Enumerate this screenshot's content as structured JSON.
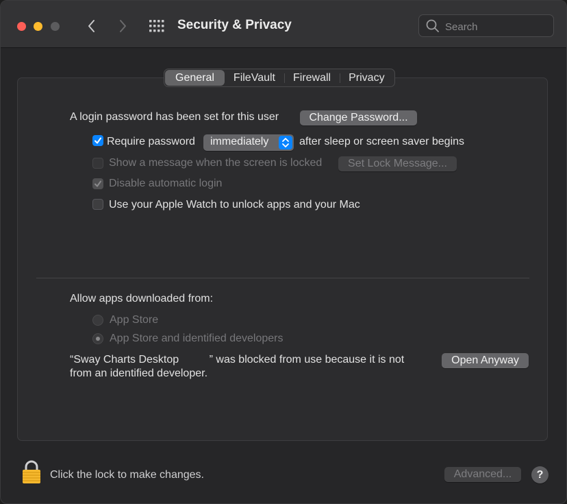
{
  "window": {
    "title": "Security & Privacy",
    "search_placeholder": "Search"
  },
  "tabs": [
    {
      "label": "General",
      "active": true
    },
    {
      "label": "FileVault",
      "active": false
    },
    {
      "label": "Firewall",
      "active": false
    },
    {
      "label": "Privacy",
      "active": false
    }
  ],
  "general": {
    "login_text": "A login password has been set for this user",
    "change_password_label": "Change Password...",
    "require_password_label": "Require password",
    "require_password_checked": true,
    "require_password_delay": "immediately",
    "after_sleep_text": "after sleep or screen saver begins",
    "show_message_label": "Show a message when the screen is locked",
    "show_message_checked": false,
    "set_lock_message_label": "Set Lock Message...",
    "disable_auto_login_label": "Disable automatic login",
    "disable_auto_login_checked": true,
    "apple_watch_label": "Use your Apple Watch to unlock apps and your Mac",
    "apple_watch_checked": false
  },
  "allow_apps": {
    "heading": "Allow apps downloaded from:",
    "options": [
      {
        "label": "App Store",
        "selected": false
      },
      {
        "label": "App Store and identified developers",
        "selected": true
      }
    ],
    "blocked_line1": "“Sway Charts Desktop          ” was blocked from use because it is not",
    "blocked_line2": "from an identified developer.",
    "open_anyway_label": "Open Anyway"
  },
  "footer": {
    "lock_text": "Click the lock to make changes.",
    "advanced_label": "Advanced...",
    "help_label": "?"
  },
  "colors": {
    "accent": "#0a84ff",
    "lock": "#f5b82e"
  }
}
